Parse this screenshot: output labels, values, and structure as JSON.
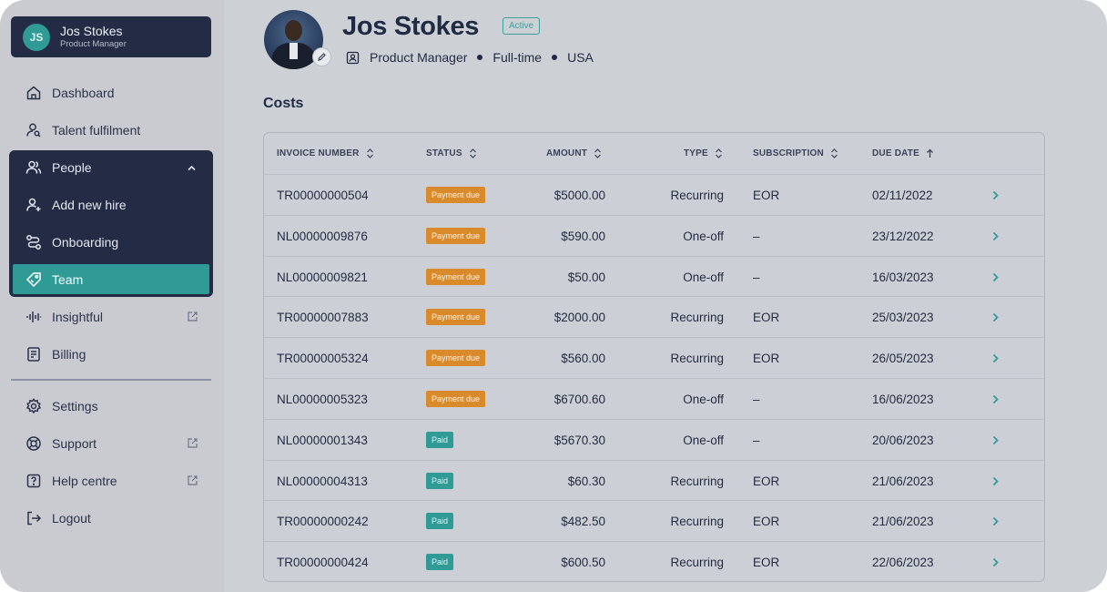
{
  "user": {
    "initials": "JS",
    "name": "Jos Stokes",
    "role": "Product Manager"
  },
  "nav": {
    "dashboard": "Dashboard",
    "talent": "Talent fulfilment",
    "people": "People",
    "add_hire": "Add new hire",
    "onboarding": "Onboarding",
    "team": "Team",
    "insightful": "Insightful",
    "billing": "Billing",
    "settings": "Settings",
    "support": "Support",
    "help": "Help centre",
    "logout": "Logout"
  },
  "profile": {
    "name": "Jos Stokes",
    "status_badge": "Active",
    "job_title": "Product Manager",
    "employment_type": "Full-time",
    "country": "USA"
  },
  "costs": {
    "title": "Costs",
    "headers": {
      "invoice": "INVOICE NUMBER",
      "status": "STATUS",
      "amount": "AMOUNT",
      "type": "TYPE",
      "subscription": "SUBSCRIPTION",
      "due": "DUE DATE"
    },
    "rows": [
      {
        "invoice": "TR00000000504",
        "status": "Payment due",
        "amount": "$5000.00",
        "type": "Recurring",
        "subscription": "EOR",
        "due": "02/11/2022"
      },
      {
        "invoice": "NL00000009876",
        "status": "Payment due",
        "amount": "$590.00",
        "type": "One-off",
        "subscription": "–",
        "due": "23/12/2022"
      },
      {
        "invoice": "NL00000009821",
        "status": "Payment due",
        "amount": "$50.00",
        "type": "One-off",
        "subscription": "–",
        "due": "16/03/2023"
      },
      {
        "invoice": "TR00000007883",
        "status": "Payment due",
        "amount": "$2000.00",
        "type": "Recurring",
        "subscription": "EOR",
        "due": "25/03/2023"
      },
      {
        "invoice": "TR00000005324",
        "status": "Payment due",
        "amount": "$560.00",
        "type": "Recurring",
        "subscription": "EOR",
        "due": "26/05/2023"
      },
      {
        "invoice": "NL00000005323",
        "status": "Payment due",
        "amount": "$6700.60",
        "type": "One-off",
        "subscription": "–",
        "due": "16/06/2023"
      },
      {
        "invoice": "NL00000001343",
        "status": "Paid",
        "amount": "$5670.30",
        "type": "One-off",
        "subscription": "–",
        "due": "20/06/2023"
      },
      {
        "invoice": "NL00000004313",
        "status": "Paid",
        "amount": "$60.30",
        "type": "Recurring",
        "subscription": "EOR",
        "due": "21/06/2023"
      },
      {
        "invoice": "TR00000000242",
        "status": "Paid",
        "amount": "$482.50",
        "type": "Recurring",
        "subscription": "EOR",
        "due": "21/06/2023"
      },
      {
        "invoice": "TR00000000424",
        "status": "Paid",
        "amount": "$600.50",
        "type": "Recurring",
        "subscription": "EOR",
        "due": "22/06/2023"
      }
    ]
  },
  "colors": {
    "sidebar_active": "#2f9a96",
    "nav_dark": "#242b45",
    "payment_due": "#d98b2b",
    "paid": "#2f9a96"
  },
  "icons": [
    "home-icon",
    "user-search-icon",
    "users-icon",
    "user-plus-icon",
    "route-icon",
    "tag-icon",
    "waveform-icon",
    "receipt-icon",
    "gear-icon",
    "lifebuoy-icon",
    "help-icon",
    "logout-icon",
    "external-link-icon",
    "sort-icon",
    "chevron-right-icon",
    "edit-icon",
    "id-badge-icon"
  ]
}
